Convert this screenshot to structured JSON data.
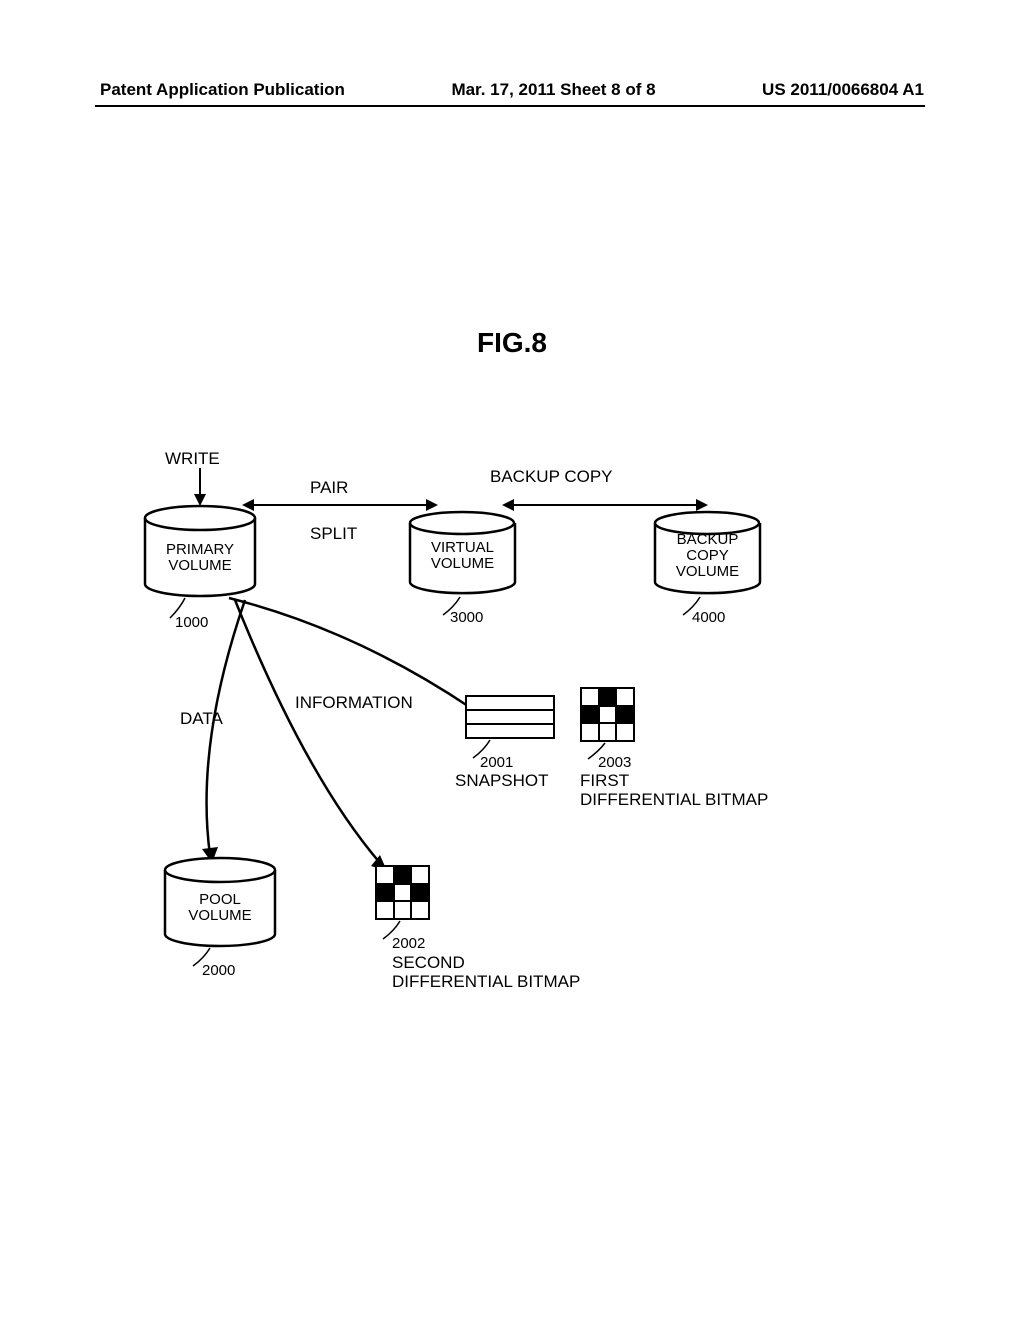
{
  "header": {
    "left": "Patent Application Publication",
    "middle": "Mar. 17, 2011  Sheet 8 of 8",
    "right": "US 2011/0066804 A1"
  },
  "figure_title": "FIG.8",
  "labels": {
    "write": "WRITE",
    "pair": "PAIR",
    "split": "SPLIT",
    "backup_copy": "BACKUP COPY",
    "primary_volume": "PRIMARY\nVOLUME",
    "virtual_volume": "VIRTUAL\nVOLUME",
    "backup_copy_volume": "BACKUP\nCOPY\nVOLUME",
    "data": "DATA",
    "information": "INFORMATION",
    "pool_volume": "POOL\nVOLUME",
    "snapshot": "SNAPSHOT",
    "first_diff": "FIRST\nDIFFERENTIAL BITMAP",
    "second_diff": "SECOND\nDIFFERENTIAL BITMAP"
  },
  "refs": {
    "primary": "1000",
    "virtual": "3000",
    "backup": "4000",
    "pool": "2000",
    "snapshot": "2001",
    "bitmap2": "2002",
    "bitmap1": "2003"
  }
}
